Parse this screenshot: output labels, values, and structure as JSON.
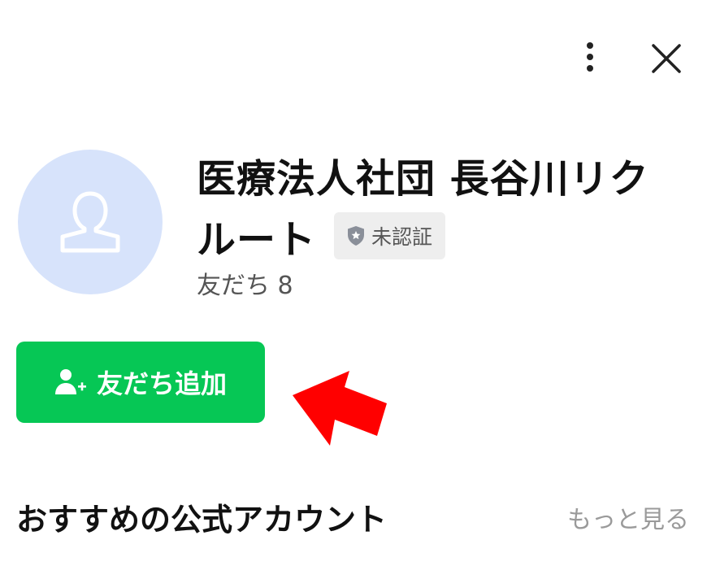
{
  "header": {
    "more_icon": "more-vertical-icon",
    "close_icon": "close-icon"
  },
  "profile": {
    "avatar_icon": "person-placeholder-icon",
    "name_line1": "医療法人社団 長谷川リク",
    "name_line2": "ルート",
    "badge_icon": "shield-star-icon",
    "badge_label": "未認証",
    "friends_count": "友だち 8"
  },
  "actions": {
    "add_friend_icon": "add-person-icon",
    "add_friend_label": "友だち追加"
  },
  "annotation": {
    "arrow_icon": "red-arrow-icon",
    "arrow_color": "#ff0000"
  },
  "recommended": {
    "title": "おすすめの公式アカウント",
    "see_more_label": "もっと見る"
  },
  "colors": {
    "accent_green": "#06c755",
    "avatar_bg": "#d7e3fb",
    "badge_bg": "#eeeeee",
    "muted_text": "#9a9a9a"
  }
}
